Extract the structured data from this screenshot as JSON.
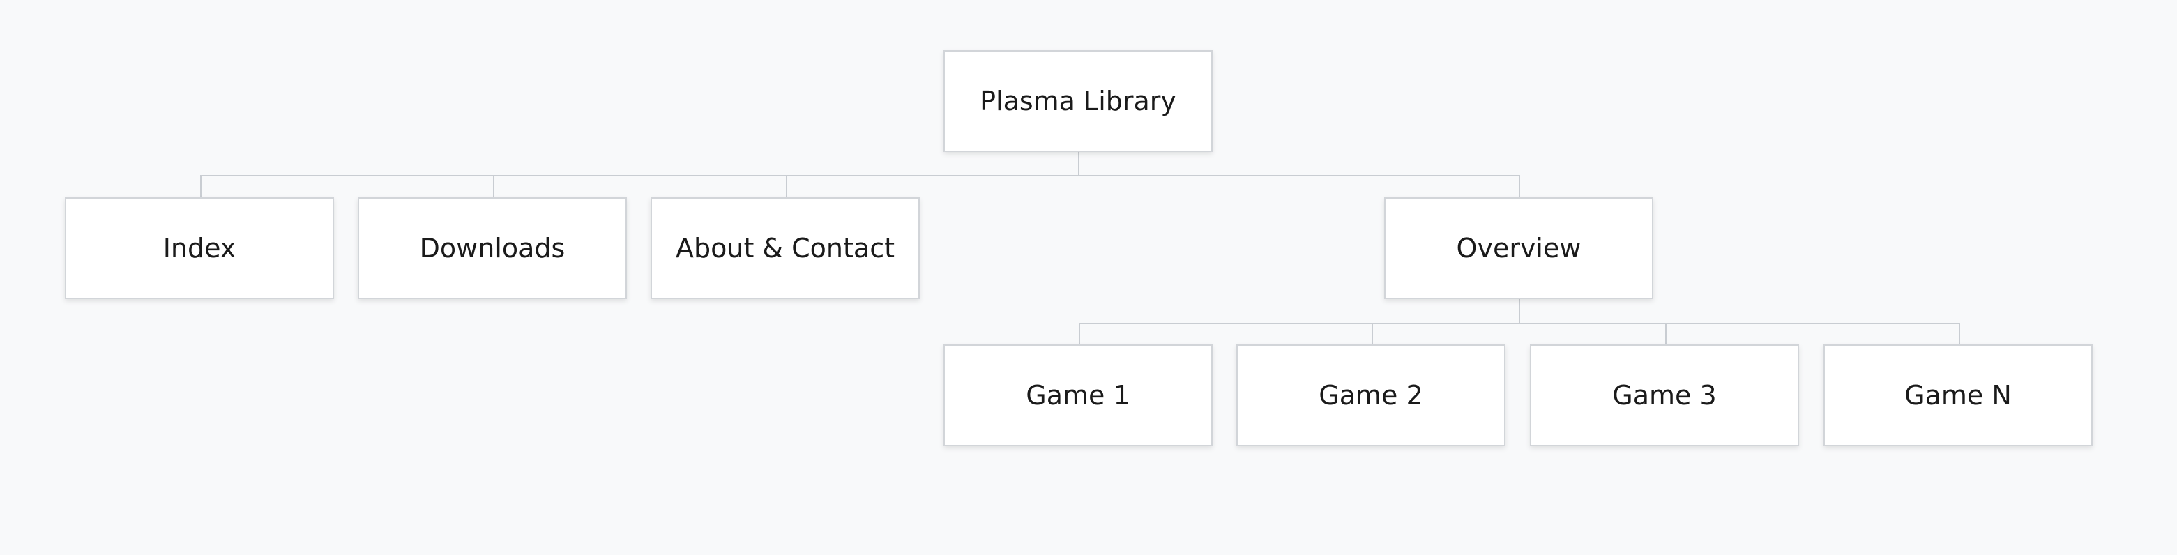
{
  "diagram": {
    "root": {
      "label": "Plasma Library"
    },
    "level1": [
      {
        "label": "Index"
      },
      {
        "label": "Downloads"
      },
      {
        "label": "About & Contact"
      },
      {
        "label": "Overview"
      }
    ],
    "games": [
      {
        "label": "Game 1"
      },
      {
        "label": "Game 2"
      },
      {
        "label": "Game 3"
      },
      {
        "label": "Game N"
      }
    ]
  },
  "colors": {
    "background": "#f8f9fa",
    "node_fill": "#ffffff",
    "node_border": "#d2d5d9",
    "connector": "#c9cdd2",
    "text": "#1a1a1a"
  }
}
